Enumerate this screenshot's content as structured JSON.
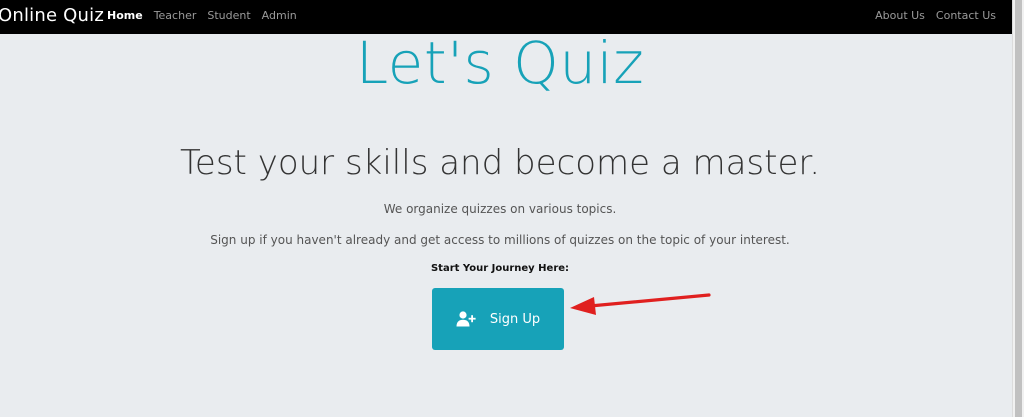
{
  "navbar": {
    "brand": "Online Quiz",
    "left_links": [
      "Home",
      "Teacher",
      "Student",
      "Admin"
    ],
    "right_links": [
      "About Us",
      "Contact Us"
    ]
  },
  "hero": {
    "title": "Let's Quiz",
    "subtitle": "Test your skills and become a master.",
    "line1": "We organize quizzes on various topics.",
    "line2": "Sign up if you haven't already and get access to millions of quizzes on the topic of your interest.",
    "journey_label": "Start Your Journey Here:",
    "signup_label": "Sign Up"
  },
  "icons": {
    "signup": "user-plus-icon",
    "annotation": "red-arrow-icon"
  },
  "colors": {
    "navbar_bg": "#000000",
    "hero_bg": "#e9ecef",
    "accent": "#17a2b8",
    "arrow": "#e0201f"
  }
}
